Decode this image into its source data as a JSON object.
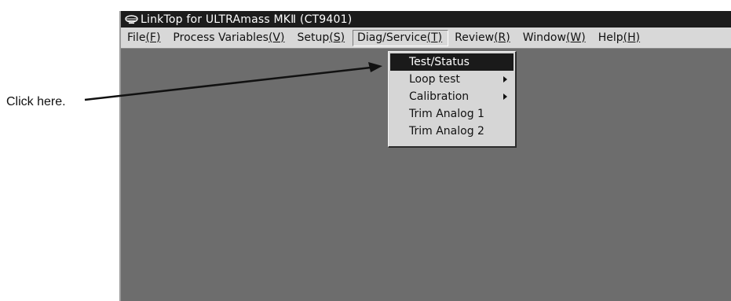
{
  "window": {
    "title": "LinkTop for ULTRAmass MKⅡ (CT9401)",
    "icon": "linktop-app-icon"
  },
  "menu": [
    {
      "label": "File",
      "mnemonic": "(F)"
    },
    {
      "label": "Process Variables",
      "mnemonic": "(V)"
    },
    {
      "label": "Setup",
      "mnemonic": "(S)"
    },
    {
      "label": "Diag/Service",
      "mnemonic": "(T)",
      "open": true
    },
    {
      "label": "Review",
      "mnemonic": "(R)"
    },
    {
      "label": "Window",
      "mnemonic": "(W)"
    },
    {
      "label": "Help",
      "mnemonic": "(H)"
    }
  ],
  "dropdown": {
    "items": [
      {
        "label": "Test/Status",
        "selected": true,
        "submenu": false
      },
      {
        "label": "Loop test",
        "selected": false,
        "submenu": true
      },
      {
        "label": "Calibration",
        "selected": false,
        "submenu": true
      },
      {
        "label": "Trim Analog 1",
        "selected": false,
        "submenu": false
      },
      {
        "label": "Trim Analog 2",
        "selected": false,
        "submenu": false
      }
    ]
  },
  "callout": {
    "text": "Click here."
  },
  "colors": {
    "title_bar": "#1c1c1c",
    "menu_bar": "#d8d8d8",
    "client_area": "#6d6d6d",
    "selection": "#1a1a1a"
  }
}
